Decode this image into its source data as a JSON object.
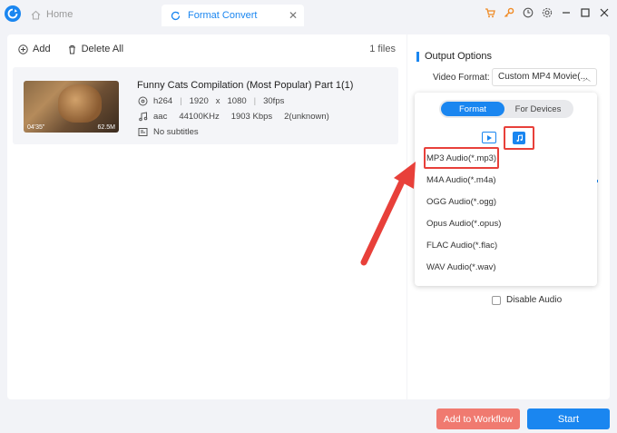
{
  "tabs": {
    "home_label": "Home",
    "convert_label": "Format Convert"
  },
  "window_icons": [
    "cart-icon",
    "key-icon",
    "clock-icon",
    "gear-icon",
    "minimize-icon",
    "maximize-icon",
    "close-icon"
  ],
  "toolbar": {
    "add_label": "Add",
    "delete_all_label": "Delete All",
    "files_count": "1 files"
  },
  "file": {
    "title": "Funny Cats Compilation (Most Popular) Part 1(1)",
    "duration": "04'35\"",
    "size": "62.5M",
    "video_codec": "h264",
    "width": "1920",
    "x_sep": "x",
    "height": "1080",
    "fps": "30fps",
    "audio_codec": "aac",
    "sample_rate": "44100KHz",
    "bitrate": "1903 Kbps",
    "channels": "2(unknown)",
    "subtitles": "No subtitles"
  },
  "output": {
    "heading": "Output Options",
    "video_format_label": "Video Format:",
    "video_format_value": "Custom MP4 Movie(...",
    "disable_audio_label": "Disable Audio"
  },
  "popup": {
    "seg_format": "Format",
    "seg_devices": "For Devices",
    "items": [
      "MP3 Audio(*.mp3)",
      "M4A Audio(*.m4a)",
      "OGG Audio(*.ogg)",
      "Opus Audio(*.opus)",
      "FLAC Audio(*.flac)",
      "WAV Audio(*.wav)"
    ]
  },
  "buttons": {
    "workflow": "Add to Workflow",
    "start": "Start"
  },
  "colors": {
    "accent": "#1a86f0",
    "highlight": "#e8403a",
    "workflow": "#f07a70"
  }
}
